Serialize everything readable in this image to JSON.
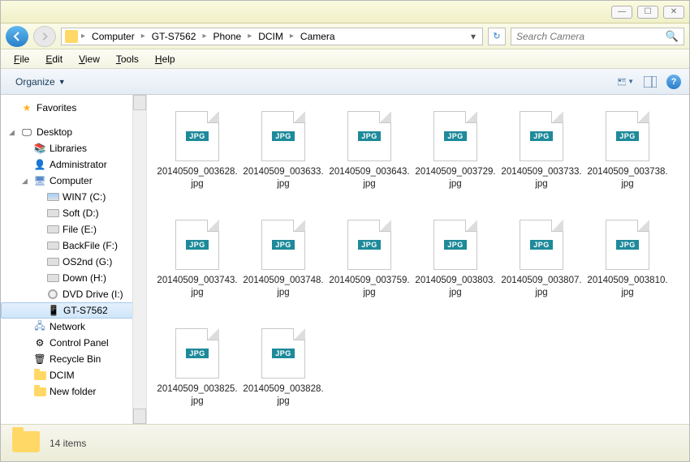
{
  "titlebar": {
    "min": "—",
    "max": "☐",
    "close": "✕"
  },
  "breadcrumb": [
    "Computer",
    "GT-S7562",
    "Phone",
    "DCIM",
    "Camera"
  ],
  "search_placeholder": "Search Camera",
  "menu": [
    "File",
    "Edit",
    "View",
    "Tools",
    "Help"
  ],
  "toolbar": {
    "organize": "Organize"
  },
  "sidebar": {
    "favorites": "Favorites",
    "desktop": "Desktop",
    "items_desktop": [
      {
        "label": "Libraries",
        "icon": "libraries"
      },
      {
        "label": "Administrator",
        "icon": "user"
      },
      {
        "label": "Computer",
        "icon": "computer",
        "expanded": true,
        "children": [
          {
            "label": "WIN7 (C:)",
            "icon": "drive-win"
          },
          {
            "label": "Soft (D:)",
            "icon": "drive"
          },
          {
            "label": "File (E:)",
            "icon": "drive"
          },
          {
            "label": "BackFile (F:)",
            "icon": "drive"
          },
          {
            "label": "OS2nd (G:)",
            "icon": "drive"
          },
          {
            "label": "Down (H:)",
            "icon": "drive"
          },
          {
            "label": "DVD Drive (I:)",
            "icon": "disc"
          },
          {
            "label": "GT-S7562",
            "icon": "device",
            "selected": true
          }
        ]
      },
      {
        "label": "Network",
        "icon": "network"
      },
      {
        "label": "Control Panel",
        "icon": "control"
      },
      {
        "label": "Recycle Bin",
        "icon": "recycle"
      },
      {
        "label": "DCIM",
        "icon": "folder"
      },
      {
        "label": "New folder",
        "icon": "folder"
      }
    ]
  },
  "files": [
    {
      "name": "20140509_003628.jpg",
      "type": "JPG"
    },
    {
      "name": "20140509_003633.jpg",
      "type": "JPG"
    },
    {
      "name": "20140509_003643.jpg",
      "type": "JPG"
    },
    {
      "name": "20140509_003729.jpg",
      "type": "JPG"
    },
    {
      "name": "20140509_003733.jpg",
      "type": "JPG"
    },
    {
      "name": "20140509_003738.jpg",
      "type": "JPG"
    },
    {
      "name": "20140509_003743.jpg",
      "type": "JPG"
    },
    {
      "name": "20140509_003748.jpg",
      "type": "JPG"
    },
    {
      "name": "20140509_003759.jpg",
      "type": "JPG"
    },
    {
      "name": "20140509_003803.jpg",
      "type": "JPG"
    },
    {
      "name": "20140509_003807.jpg",
      "type": "JPG"
    },
    {
      "name": "20140509_003810.jpg",
      "type": "JPG"
    },
    {
      "name": "20140509_003825.jpg",
      "type": "JPG"
    },
    {
      "name": "20140509_003828.jpg",
      "type": "JPG"
    }
  ],
  "status": {
    "count_text": "14 items"
  }
}
